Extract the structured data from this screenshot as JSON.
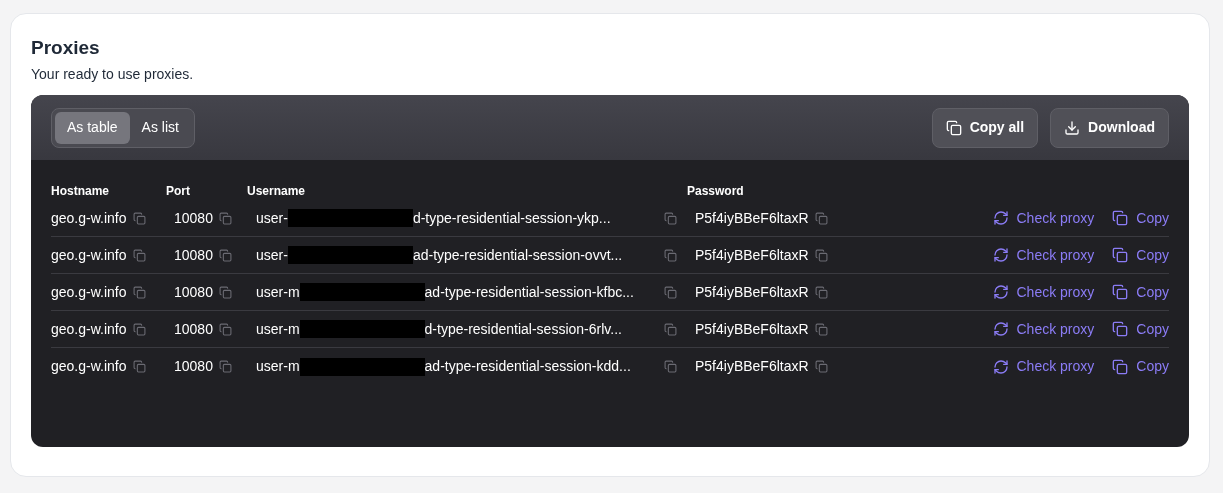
{
  "title": "Proxies",
  "subtitle": "Your ready to use proxies.",
  "view_tabs": [
    {
      "label": "As table",
      "selected": true
    },
    {
      "label": "As list",
      "selected": false
    }
  ],
  "actions": [
    {
      "label": "Copy all",
      "kind": "copy"
    },
    {
      "label": "Download",
      "kind": "download"
    }
  ],
  "table": {
    "columns": [
      "Hostname",
      "Port",
      "Username",
      "Password"
    ],
    "rows": [
      {
        "hostname": "geo.g-w.info",
        "port": "10080",
        "username_start": "user-",
        "username_end": "d-type-residential-session-ykp...",
        "password": "P5f4iyBBeF6ltaxR",
        "check": "Check proxy",
        "copy": "Copy"
      },
      {
        "hostname": "geo.g-w.info",
        "port": "10080",
        "username_start": "user-",
        "username_end": "ad-type-residential-session-ovvt...",
        "password": "P5f4iyBBeF6ltaxR",
        "check": "Check proxy",
        "copy": "Copy"
      },
      {
        "hostname": "geo.g-w.info",
        "port": "10080",
        "username_start": "user-m",
        "username_end": "ad-type-residential-session-kfbc...",
        "password": "P5f4iyBBeF6ltaxR",
        "check": "Check proxy",
        "copy": "Copy"
      },
      {
        "hostname": "geo.g-w.info",
        "port": "10080",
        "username_start": "user-m",
        "username_end": "d-type-residential-session-6rlv...",
        "password": "P5f4iyBBeF6ltaxR",
        "check": "Check proxy",
        "copy": "Copy"
      },
      {
        "hostname": "geo.g-w.info",
        "port": "10080",
        "username_start": "user-m",
        "username_end": "ad-type-residential-session-kdd...",
        "password": "P5f4iyBBeF6ltaxR",
        "check": "Check proxy",
        "copy": "Copy"
      }
    ]
  }
}
